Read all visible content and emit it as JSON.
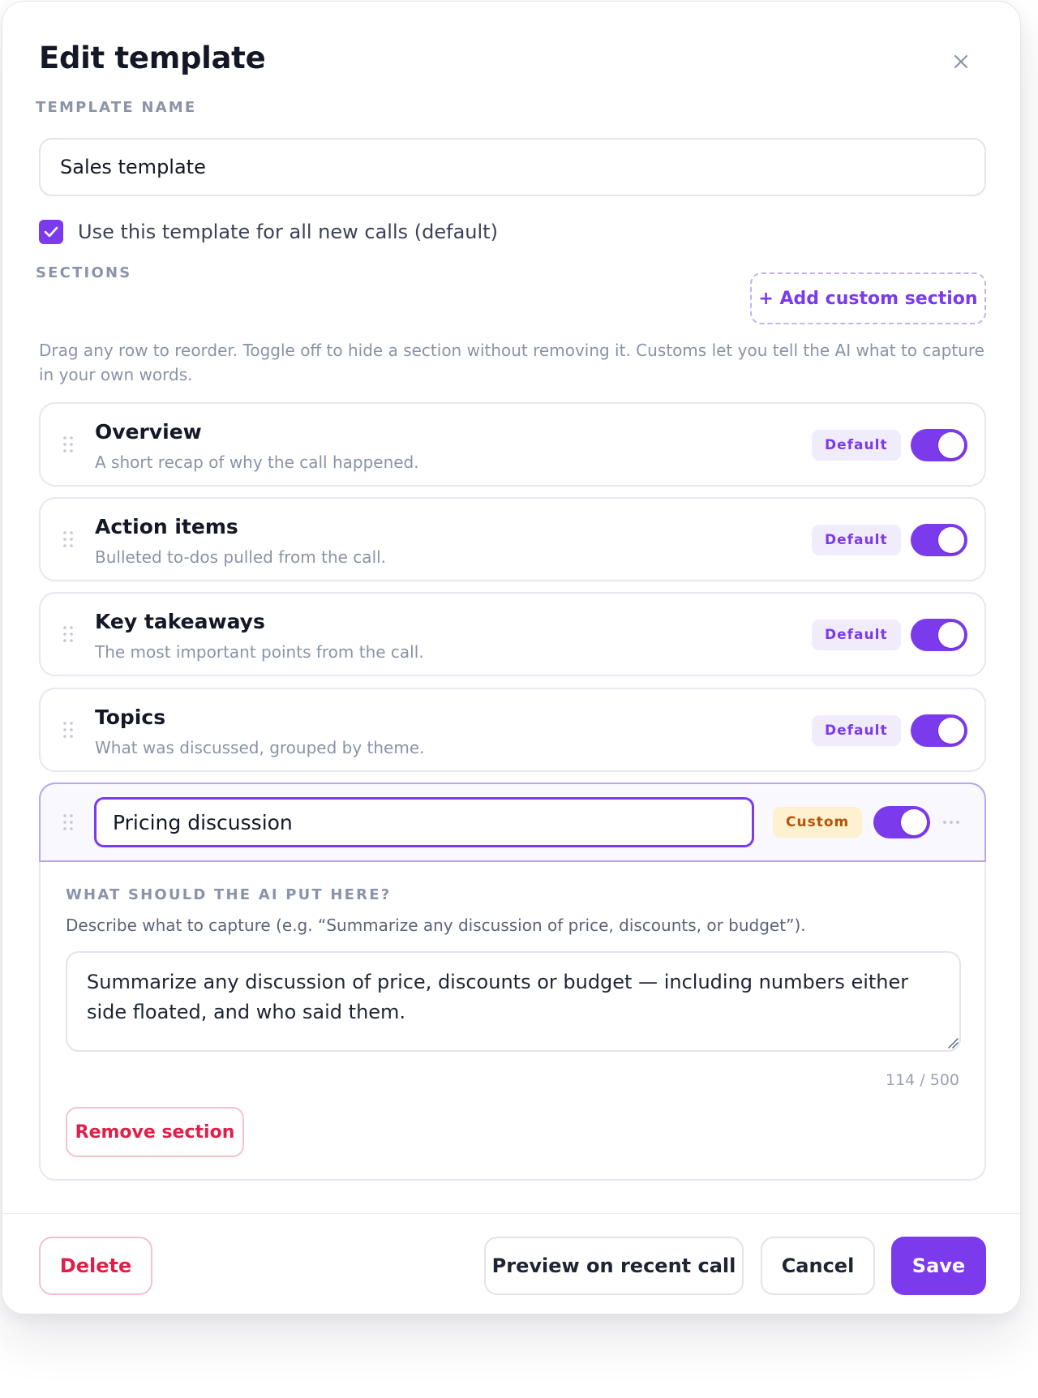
{
  "modal": {
    "title": "Edit template",
    "close_icon": "close-icon"
  },
  "template_name": {
    "label": "TEMPLATE NAME",
    "value": "Sales template"
  },
  "default_option": {
    "checked": true,
    "label": "Use this template for all new calls (default)"
  },
  "sections": {
    "label": "SECTIONS",
    "add_button": "+ Add custom section",
    "help": "Drag any row to reorder. Toggle off to hide a section without removing it. Customs let you tell the AI what to capture in your own words.",
    "items": [
      {
        "title": "Overview",
        "description": "A short recap of why the call happened.",
        "badge": "Default",
        "enabled": true
      },
      {
        "title": "Action items",
        "description": "Bulleted to-dos pulled from the call.",
        "badge": "Default",
        "enabled": true
      },
      {
        "title": "Key takeaways",
        "description": "The most important points from the call.",
        "badge": "Default",
        "enabled": true
      },
      {
        "title": "Topics",
        "description": "What was discussed, grouped by theme.",
        "badge": "Default",
        "enabled": true
      }
    ],
    "custom": {
      "name": "Pricing discussion",
      "badge": "Custom",
      "enabled": true,
      "more_label": "···",
      "prompt_label": "WHAT SHOULD THE AI PUT HERE?",
      "prompt_hint": "Describe what to capture (e.g. “Summarize any discussion of price, discounts, or budget”).",
      "prompt_value": "Summarize any discussion of price, discounts or budget — including numbers either side floated, and who said them.",
      "char_count": "114 / 500",
      "remove_label": "Remove section"
    }
  },
  "footer": {
    "delete": "Delete",
    "preview": "Preview on recent call",
    "cancel": "Cancel",
    "save": "Save"
  },
  "colors": {
    "accent": "#7c3aed",
    "danger": "#e11d48",
    "custom_badge_bg": "#fdf1cf",
    "custom_badge_text": "#b45309",
    "default_badge_bg": "#f1ecfc"
  }
}
